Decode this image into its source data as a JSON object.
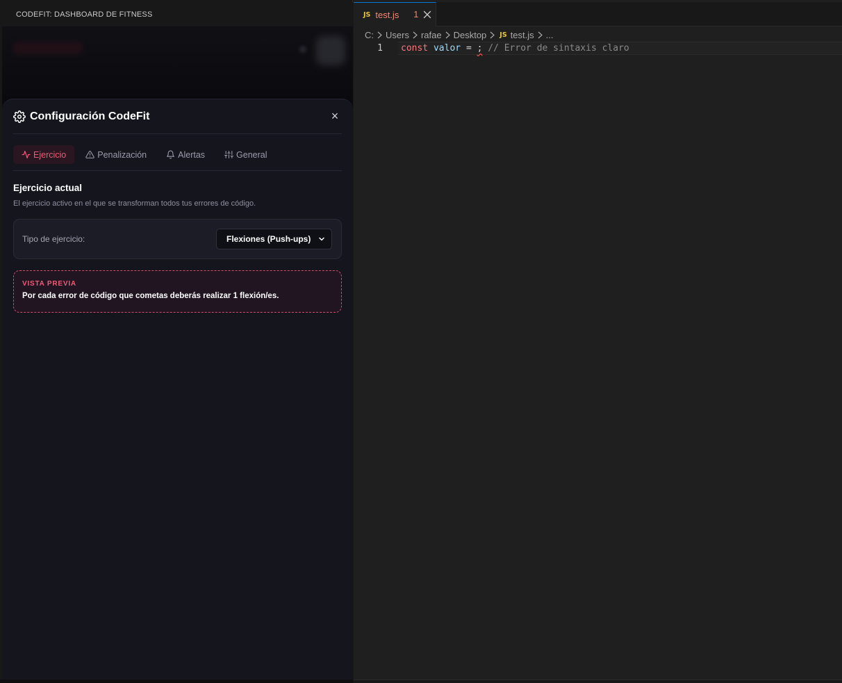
{
  "panel": {
    "title": "CODEFIT: DASHBOARD DE FITNESS"
  },
  "modal": {
    "title": "Configuración CodeFit",
    "close_label": "×",
    "tabs": [
      {
        "label": "Ejercicio",
        "icon": "activity-icon",
        "active": true
      },
      {
        "label": "Penalización",
        "icon": "warning-triangle-icon",
        "active": false
      },
      {
        "label": "Alertas",
        "icon": "bell-icon",
        "active": false
      },
      {
        "label": "General",
        "icon": "sliders-icon",
        "active": false
      }
    ],
    "section_title": "Ejercicio actual",
    "section_desc": "El ejercicio activo en el que se transforman todos tus errores de código.",
    "exercise_label": "Tipo de ejercicio:",
    "exercise_selected": "Flexiones (Push-ups)",
    "preview_label": "VISTA PREVIA",
    "preview_text": "Por cada error de código que cometas deberás realizar 1 flexión/es."
  },
  "editor": {
    "tab": {
      "icon": "JS",
      "name": "test.js",
      "problems": "1"
    },
    "breadcrumb": [
      "C:",
      "Users",
      "rafae",
      "Desktop"
    ],
    "breadcrumb_file": "test.js",
    "breadcrumb_more": "...",
    "line_number": "1",
    "code": {
      "keyword": "const",
      "variable": "valor",
      "operator": "=",
      "error_token": ";",
      "comment": "// Error de sintaxis claro"
    }
  },
  "colors": {
    "accent": "#ef5a78",
    "modal_bg": "#14151d",
    "editor_bg": "#1f1f1f",
    "tab_border": "#0078d4"
  }
}
